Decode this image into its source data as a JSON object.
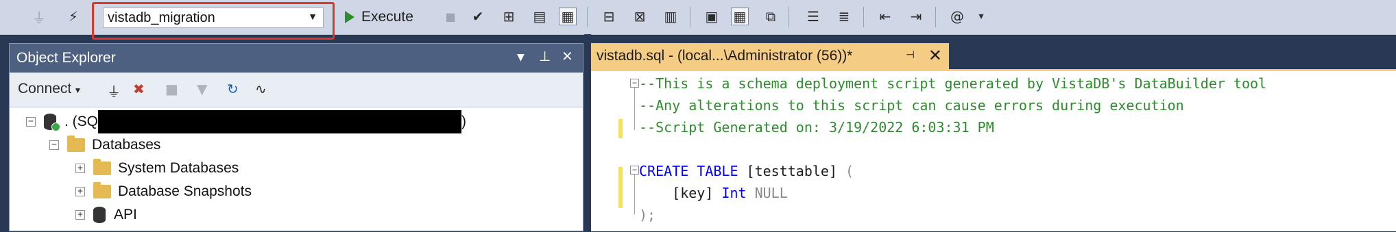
{
  "toolbar": {
    "database_selector": {
      "value": "vistadb_migration"
    },
    "execute_label": "Execute",
    "icons": [
      "connect-icon",
      "disconnect-icon",
      "change-connection-icon",
      "stop-icon",
      "parse-checkmark-icon",
      "display-plan-icon",
      "results-to-grid-icon",
      "results-to-text-icon",
      "results-to-file-icon",
      "query-options-icon",
      "intellisense-icon",
      "comment-icon",
      "uncomment-icon",
      "decrease-indent-icon",
      "increase-indent-icon",
      "specify-values-icon",
      "overflow-icon"
    ]
  },
  "object_explorer": {
    "title": "Object Explorer",
    "connect_label": "Connect",
    "tree": {
      "server_prefix": ". (SQ",
      "server_suffix": ")",
      "databases_label": "Databases",
      "children": [
        {
          "label": "System Databases",
          "type": "folder"
        },
        {
          "label": "Database Snapshots",
          "type": "folder"
        },
        {
          "label": "API",
          "type": "database"
        }
      ]
    }
  },
  "editor": {
    "tab_title": "vistadb.sql - (local...\\Administrator (56))*",
    "lines": {
      "l1": "--This is a schema deployment script generated by VistaDB's DataBuilder tool",
      "l2": "--Any alterations to this script can cause errors during execution",
      "l3": "--Script Generated on: 3/19/2022 6:03:31 PM",
      "l5_kw": "CREATE TABLE",
      "l5_name": " [testtable] ",
      "l5_paren": "(",
      "l6_col": "    [key] ",
      "l6_type": "Int",
      "l6_null": " NULL",
      "l7": ");"
    }
  },
  "colors": {
    "accent_red": "#d9382b",
    "tab_yellow": "#f5cc84",
    "comment_green": "#2e8b2e",
    "keyword_blue": "#0000ff"
  }
}
